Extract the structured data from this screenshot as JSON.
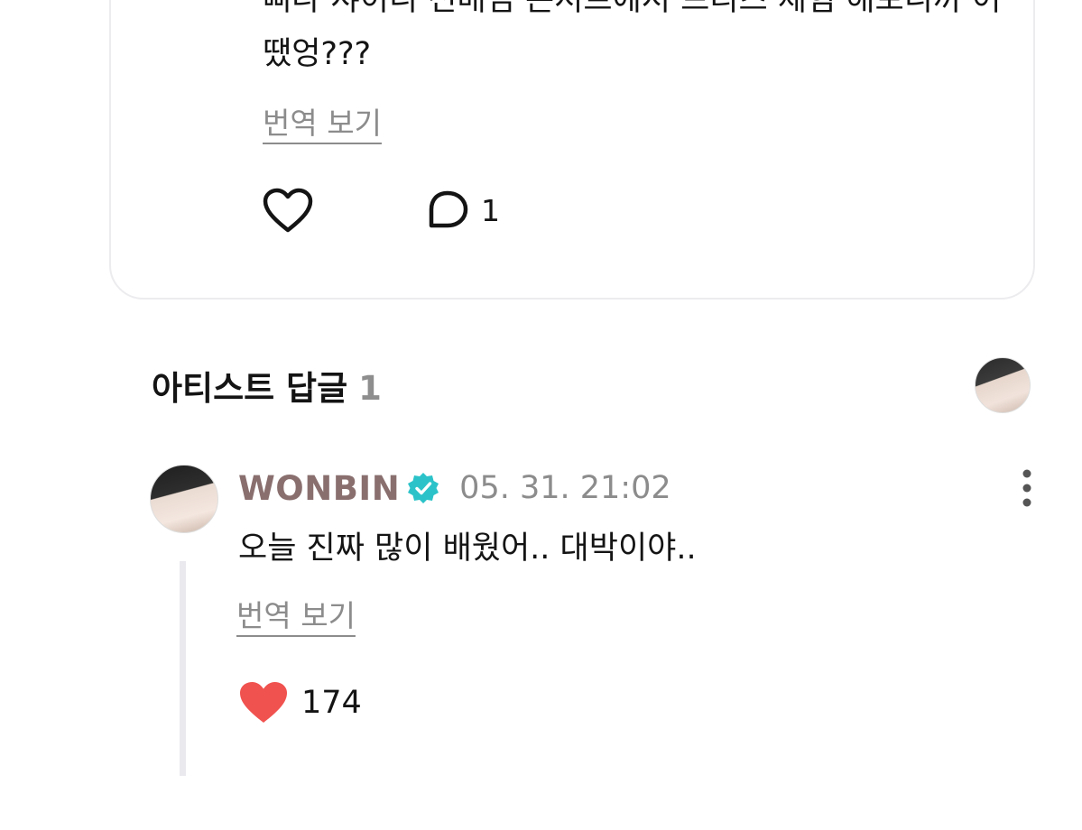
{
  "post": {
    "body": "삐나 샤이니 선배님 콘서트에서 브리즈 체험 해보니까 어땠엉???",
    "translate_label": "번역 보기",
    "comment_count": "1",
    "like_icon": "heart-outline-icon",
    "comment_icon": "speech-bubble-icon"
  },
  "artist_replies": {
    "title": "아티스트 답글",
    "count": "1"
  },
  "reply": {
    "author": "WONBIN",
    "date": "05. 31. 21:02",
    "body": "오늘 진짜 많이 배웠어.. 대박이야..",
    "translate_label": "번역 보기",
    "like_count": "174",
    "liked": true,
    "verified": true,
    "more_icon": "vertical-ellipsis-icon"
  },
  "colors": {
    "author_name": "#8a6f6f",
    "verified_badge": "#2bc3c9",
    "heart_filled": "#f0524f",
    "muted_text": "#8c8c8c",
    "card_border": "#ececef",
    "thread_line": "#e9e9ee"
  }
}
